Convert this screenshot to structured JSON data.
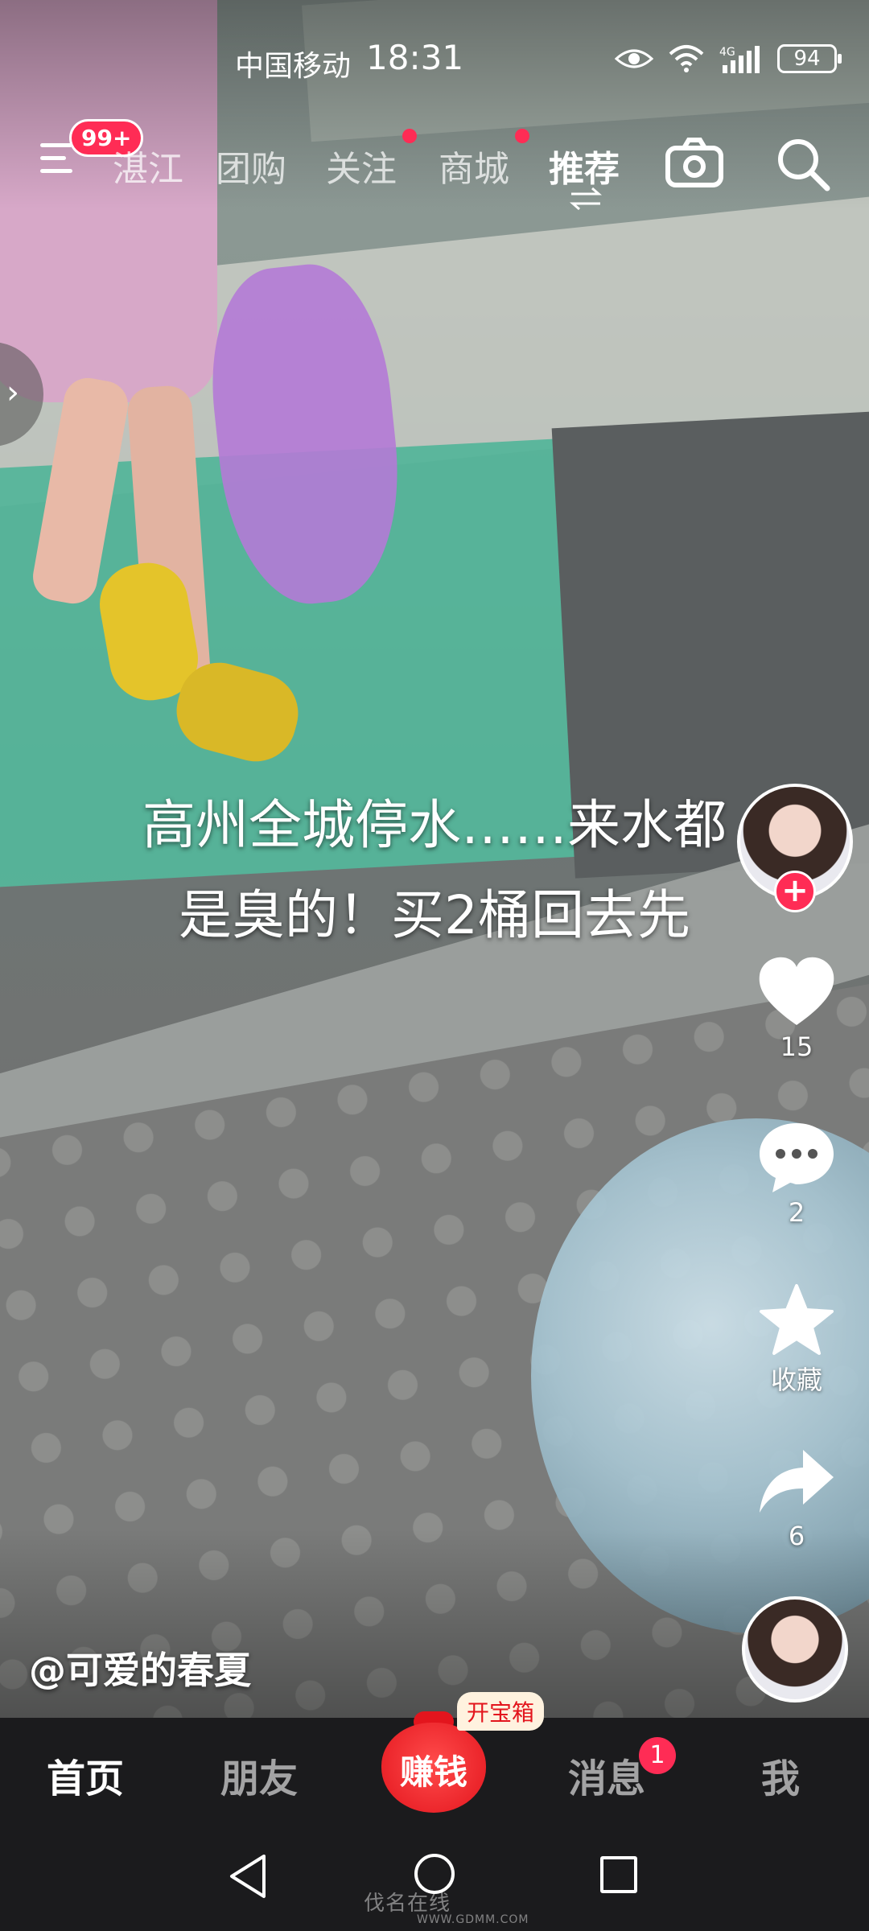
{
  "status_bar": {
    "carrier": "中国移动",
    "time": "18:31",
    "network": "4G",
    "battery": "94"
  },
  "top_nav": {
    "menu_badge": "99+",
    "tabs": [
      {
        "label": "湛江",
        "active": false,
        "dot": false
      },
      {
        "label": "团购",
        "active": false,
        "dot": false
      },
      {
        "label": "关注",
        "active": false,
        "dot": true
      },
      {
        "label": "商城",
        "active": false,
        "dot": true
      },
      {
        "label": "推荐",
        "active": true,
        "dot": false
      }
    ]
  },
  "video": {
    "caption_line1": "高州全城停水……来水都",
    "caption_line2": "是臭的！买2桶回去先",
    "author": "@可爱的春夏"
  },
  "right_rail": {
    "likes": "15",
    "comments": "2",
    "favorite_label": "收藏",
    "shares": "6"
  },
  "bottom_tabs": {
    "home": "首页",
    "friends": "朋友",
    "earn": "赚钱",
    "treasure": "开宝箱",
    "messages": "消息",
    "messages_badge": "1",
    "me": "我"
  },
  "watermark": {
    "text": "伐名在线",
    "url": "WWW.GDMM.COM"
  },
  "colors": {
    "accent": "#ff2c55",
    "earn_red": "#e3151d",
    "tabbar_bg": "#1b1b1d"
  }
}
